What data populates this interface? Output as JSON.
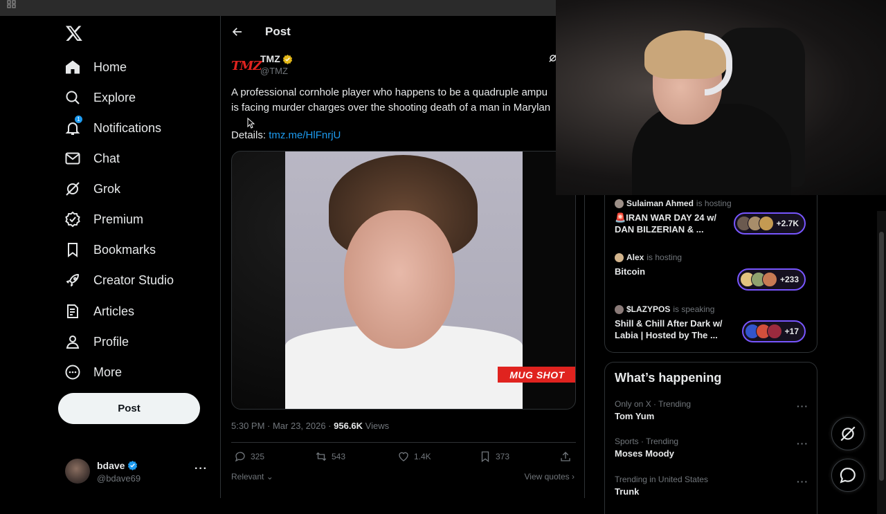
{
  "nav": {
    "logo": "x-logo",
    "items": [
      {
        "label": "Home",
        "icon": "home-icon"
      },
      {
        "label": "Explore",
        "icon": "search-icon"
      },
      {
        "label": "Notifications",
        "icon": "bell-icon",
        "badge": "1"
      },
      {
        "label": "Chat",
        "icon": "mail-icon"
      },
      {
        "label": "Grok",
        "icon": "grok-icon"
      },
      {
        "label": "Premium",
        "icon": "verified-icon"
      },
      {
        "label": "Bookmarks",
        "icon": "bookmark-icon"
      },
      {
        "label": "Creator Studio",
        "icon": "rocket-icon"
      },
      {
        "label": "Articles",
        "icon": "article-icon"
      },
      {
        "label": "Profile",
        "icon": "person-icon"
      },
      {
        "label": "More",
        "icon": "more-circle-icon"
      }
    ],
    "post_label": "Post",
    "account": {
      "name": "bdave",
      "handle": "@bdave69",
      "more": "···"
    }
  },
  "main": {
    "title": "Post",
    "tweet": {
      "logo_text": "TMZ",
      "author": "TMZ",
      "handle": "@TMZ",
      "text_line1": "A professional cornhole player who happens to be a quadruple ampu",
      "text_line2": "is facing murder charges over the shooting death of a man in Marylan",
      "details_label": "Details: ",
      "details_link": "tmz.me/HlFnrjU",
      "media_label": "MUG SHOT",
      "time": "5:30 PM · Mar 23, 2026 · ",
      "views_count": "956.6K",
      "views_label": " Views",
      "replies": "325",
      "reposts": "543",
      "likes": "1.4K",
      "bookmarks": "373",
      "relevant": "Relevant",
      "view_quotes": "View quotes"
    }
  },
  "spaces": [
    {
      "host": "Sulaiman Ahmed",
      "status": "is hosting",
      "title": "🚨IRAN WAR DAY 24 w/ DAN BILZERIAN & ...",
      "count": "+2.7K"
    },
    {
      "host": "Alex",
      "status": "is hosting",
      "title": "Bitcoin",
      "count": "+233"
    },
    {
      "host": "$LAZYPOS",
      "status": "is speaking",
      "title": "Shill & Chill After Dark w/ Labia | Hosted by The ...",
      "count": "+17"
    }
  ],
  "happening": {
    "title": "What’s happening",
    "trends": [
      {
        "category": "Only on X · Trending",
        "name": "Tom Yum"
      },
      {
        "category": "Sports · Trending",
        "name": "Moses Moody"
      },
      {
        "category": "Trending in United States",
        "name": "Trunk"
      }
    ]
  },
  "colors": {
    "accent": "#1d9bf0",
    "spaces": "#7856ff",
    "tmz_red": "#e0231f"
  }
}
